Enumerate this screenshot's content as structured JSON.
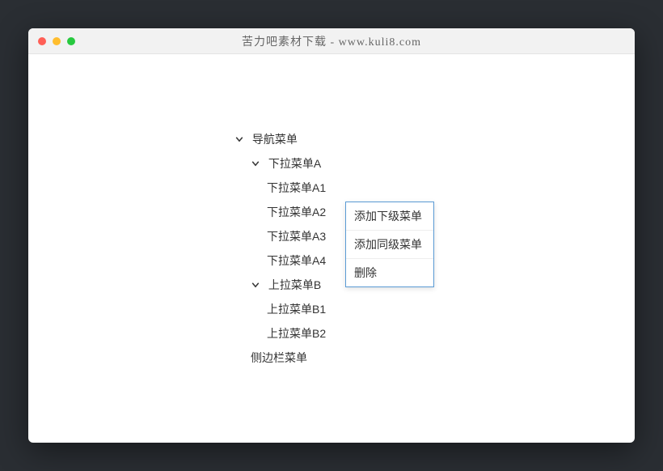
{
  "window": {
    "title": "苦力吧素材下载 - www.kuli8.com"
  },
  "tree": {
    "root_label": "导航菜单",
    "nodeA": {
      "label": "下拉菜单A",
      "children": [
        "下拉菜单A1",
        "下拉菜单A2",
        "下拉菜单A3",
        "下拉菜单A4"
      ]
    },
    "nodeB": {
      "label": "上拉菜单B",
      "children": [
        "上拉菜单B1",
        "上拉菜单B2"
      ]
    },
    "nodeC_label": "侧边栏菜单"
  },
  "context_menu": {
    "add_child": "添加下级菜单",
    "add_sibling": "添加同级菜单",
    "delete": "删除"
  }
}
